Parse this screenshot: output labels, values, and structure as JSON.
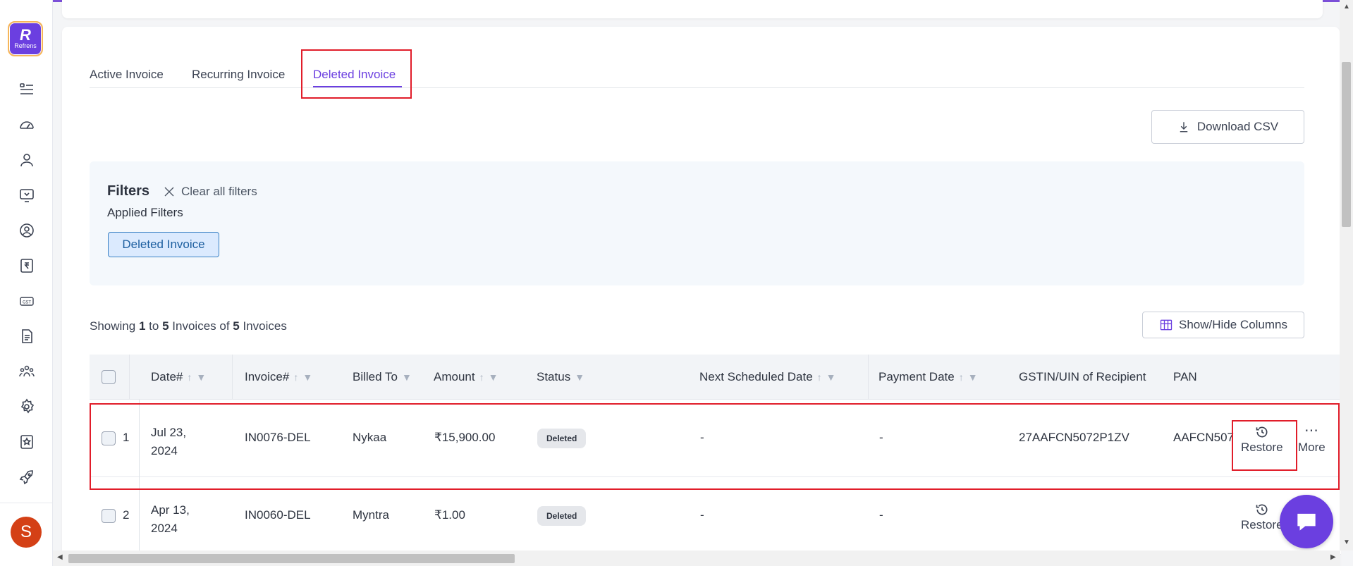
{
  "brand": {
    "logo_text": "Refrens",
    "accent": "#6b3fe0"
  },
  "sidebar": {
    "icons": [
      "menu-list-icon",
      "dashboard-gauge-icon",
      "user-icon",
      "monitor-sale-icon",
      "user-circle-icon",
      "rupee-doc-icon",
      "gst-icon",
      "document-icon",
      "team-icon",
      "settings-gear-icon",
      "star-badge-icon",
      "rocket-icon"
    ],
    "avatar_initial": "S"
  },
  "tabs": [
    {
      "label": "Active Invoice"
    },
    {
      "label": "Recurring Invoice"
    },
    {
      "label": "Deleted Invoice",
      "active": true
    }
  ],
  "download_csv": "Download CSV",
  "filters": {
    "title": "Filters",
    "clear_all": "Clear all filters",
    "applied_label": "Applied Filters",
    "chips": [
      "Deleted Invoice"
    ]
  },
  "showing": {
    "prefix": "Showing",
    "from": "1",
    "to_word": "to",
    "to": "5",
    "mid": "Invoices of",
    "total": "5",
    "suffix": "Invoices"
  },
  "show_hide_columns": "Show/Hide Columns",
  "table": {
    "columns": {
      "date": "Date#",
      "invoice": "Invoice#",
      "billed_to": "Billed To",
      "amount": "Amount",
      "status": "Status",
      "next_scheduled": "Next Scheduled Date",
      "payment_date": "Payment Date",
      "gstin": "GSTIN/UIN of Recipient",
      "pan": "PAN"
    },
    "rows": [
      {
        "num": "1",
        "date": "Jul 23, 2024",
        "invoice": "IN0076-DEL",
        "billed_to": "Nykaa",
        "amount": "₹15,900.00",
        "status": "Deleted",
        "next_scheduled": "-",
        "payment_date": "-",
        "gstin": "27AAFCN5072P1ZV",
        "pan": "AAFCN507",
        "action": "Restore",
        "more": "More"
      },
      {
        "num": "2",
        "date": "Apr 13, 2024",
        "invoice": "IN0060-DEL",
        "billed_to": "Myntra",
        "amount": "₹1.00",
        "status": "Deleted",
        "next_scheduled": "-",
        "payment_date": "-",
        "gstin": "",
        "pan": "",
        "action": "Restore",
        "more": "More"
      }
    ]
  },
  "highlight_color": "#e11d2a"
}
